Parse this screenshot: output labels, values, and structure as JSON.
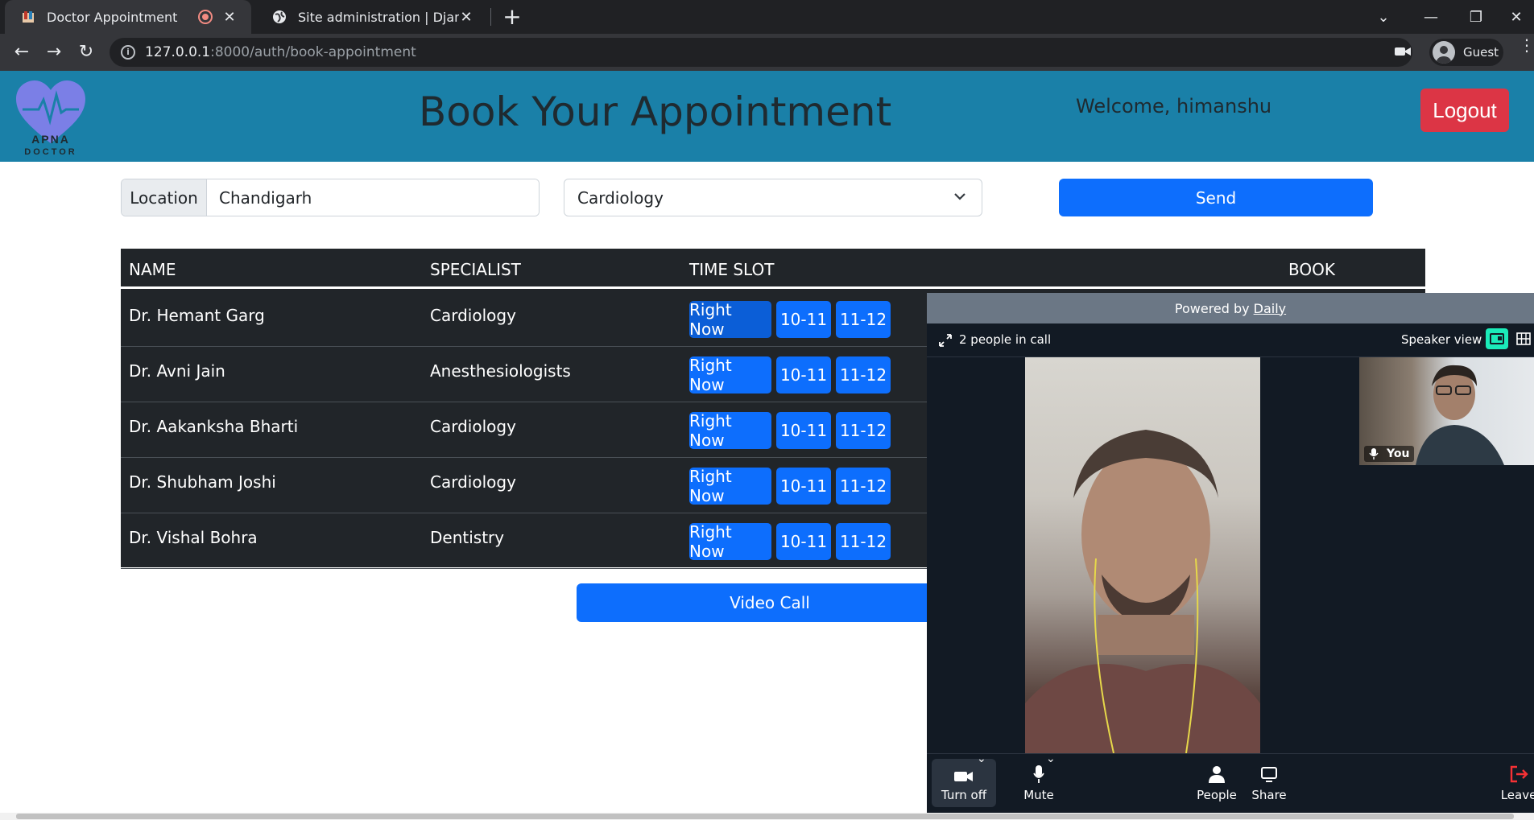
{
  "browser": {
    "tabs": [
      {
        "title": "Doctor Appointment",
        "active": true,
        "recording": true
      },
      {
        "title": "Site administration | Django site a",
        "active": false
      }
    ],
    "url_host": "127.0.0.1",
    "url_rest": ":8000/auth/book-appointment",
    "profile_label": "Guest"
  },
  "header": {
    "logo_line1": "APNA",
    "logo_line2": "DOCTOR",
    "title": "Book Your Appointment",
    "welcome": "Welcome, himanshu",
    "logout_label": "Logout"
  },
  "form": {
    "location_label": "Location",
    "location_value": "Chandigarh",
    "specialty_selected": "Cardiology",
    "send_label": "Send"
  },
  "table": {
    "headers": [
      "NAME",
      "SPECIALIST",
      "TIME SLOT",
      "BOOK"
    ],
    "rows": [
      {
        "name": "Dr. Hemant Garg",
        "specialist": "Cardiology",
        "slots": [
          "Right Now",
          "10-11",
          "11-12"
        ]
      },
      {
        "name": "Dr. Avni Jain",
        "specialist": "Anesthesiologists",
        "slots": [
          "Right Now",
          "10-11",
          "11-12"
        ]
      },
      {
        "name": "Dr. Aakanksha Bharti",
        "specialist": "Cardiology",
        "slots": [
          "Right Now",
          "10-11",
          "11-12"
        ]
      },
      {
        "name": "Dr. Shubham Joshi",
        "specialist": "Cardiology",
        "slots": [
          "Right Now",
          "10-11",
          "11-12"
        ]
      },
      {
        "name": "Dr. Vishal Bohra",
        "specialist": "Dentistry",
        "slots": [
          "Right Now",
          "10-11",
          "11-12"
        ]
      }
    ]
  },
  "video_call_label": "Video Call",
  "daily": {
    "powered_by": "Powered by",
    "powered_link": "Daily",
    "people_count": "2 people in call",
    "view_label": "Speaker view",
    "self_label": "You",
    "controls": {
      "camera": "Turn off",
      "mic": "Mute",
      "people": "People",
      "share": "Share",
      "leave": "Leave"
    }
  },
  "colors": {
    "header_bg": "#1a80a8",
    "primary": "#0d6efd",
    "danger": "#dc3545",
    "table_bg": "#212529",
    "daily_accent": "#1bebb9"
  }
}
